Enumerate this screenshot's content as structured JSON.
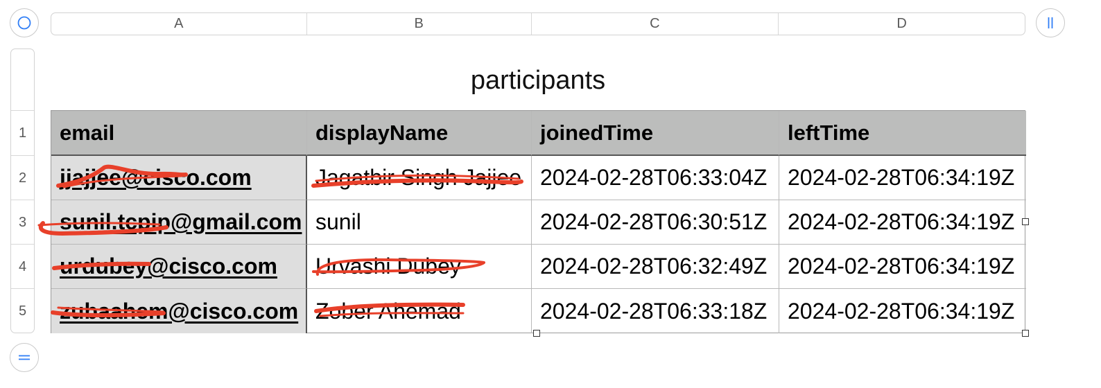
{
  "columns": [
    "A",
    "B",
    "C",
    "D"
  ],
  "rows": [
    "1",
    "2",
    "3",
    "4",
    "5"
  ],
  "table": {
    "title": "participants",
    "headers": [
      "email",
      "displayName",
      "joinedTime",
      "leftTime"
    ],
    "body": [
      [
        "jjajjee@cisco.com",
        "Jagatbir Singh Jajjee",
        "2024-02-28T06:33:04Z",
        "2024-02-28T06:34:19Z"
      ],
      [
        "sunil.tcpip@gmail.com",
        "sunil",
        "2024-02-28T06:30:51Z",
        "2024-02-28T06:34:19Z"
      ],
      [
        "urdubey@cisco.com",
        "Urvashi Dubey",
        "2024-02-28T06:32:49Z",
        "2024-02-28T06:34:19Z"
      ],
      [
        "zubaahem@cisco.com",
        "Zober Ahemad",
        "2024-02-28T06:33:18Z",
        "2024-02-28T06:34:19Z"
      ]
    ]
  },
  "icons": {
    "table_select": "circle-select-icon",
    "add_column": "column-handle-icon",
    "add_row": "row-handle-icon"
  },
  "colors": {
    "accent": "#2f7ef6",
    "redaction": "#e8402a",
    "header_fill": "#bcbdbc",
    "first_column_fill": "#dedede"
  }
}
